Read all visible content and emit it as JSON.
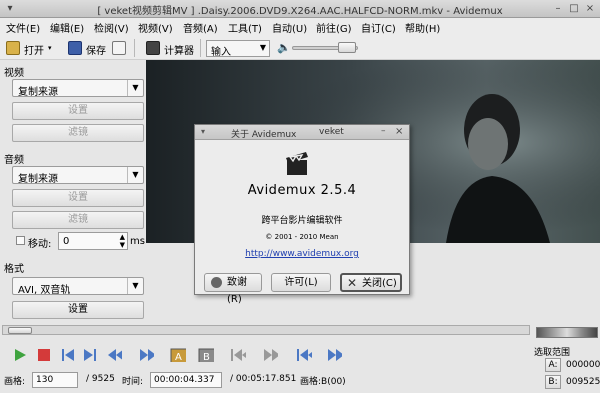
{
  "window": {
    "title": "[ veket视频剪辑MV ] .Daisy.2006.DVD9.X264.AAC.HALFCD-NORM.mkv - Avidemux"
  },
  "menu": [
    "文件(E)",
    "编辑(E)",
    "检阅(V)",
    "视频(V)",
    "音频(A)",
    "工具(T)",
    "自动(U)",
    "前往(G)",
    "自订(C)",
    "帮助(H)"
  ],
  "toolbar": {
    "open_label": "打开",
    "save_label": "保存",
    "calc_label": "计算器",
    "input_select": "输入"
  },
  "left": {
    "video_header": "视频",
    "video_codec": "复制来源",
    "video_settings": "设置",
    "video_filters": "滤镜",
    "audio_header": "音频",
    "audio_codec": "复制来源",
    "audio_settings": "设置",
    "audio_filters": "滤镜",
    "shift_label": "移动:",
    "shift_value": "0",
    "shift_unit": "ms",
    "format_header": "格式",
    "format_value": "AVI, 双音轨",
    "format_settings": "设置"
  },
  "about": {
    "dialog_title": "关于 Avidemux",
    "dialog_title_extra": "veket",
    "app_name": "Avidemux 2.5.4",
    "description": "跨平台影片编辑软件",
    "copyright": "© 2001 - 2010 Mean",
    "url": "http://www.avidemux.org",
    "credits_btn": "致谢(R)",
    "license_btn": "许可(L)",
    "close_btn": "关闭(C)"
  },
  "status": {
    "frame_label": "画格:",
    "frame_value": "130",
    "total_frames": "/ 9525",
    "time_label": "时间:",
    "time_value": "00:00:04.337",
    "total_time": "/ 00:05:17.851",
    "frametype": "画格:B(00)",
    "selection_label": "选取范围",
    "a_label": "A:",
    "a_value": "000000",
    "b_label": "B:",
    "b_value": "009525"
  },
  "colors": {
    "play_green": "#3fa33f",
    "stop_red": "#d43a3a",
    "nav_blue": "#4b78c4"
  }
}
